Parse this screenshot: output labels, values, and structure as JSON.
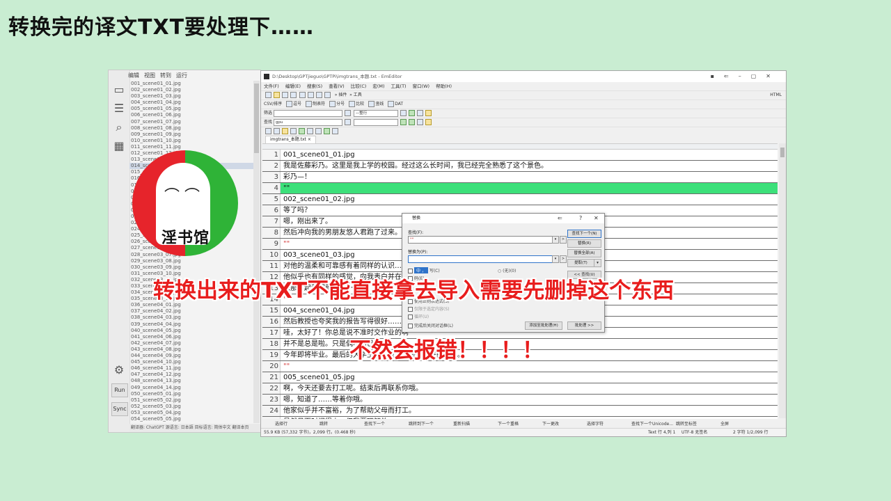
{
  "page_heading": "转换完的译文TXT要处理下……",
  "left_app": {
    "menu": [
      "编辑",
      "视图",
      "转到",
      "运行"
    ],
    "files": [
      "001_scene01_01.jpg",
      "002_scene01_02.jpg",
      "003_scene01_03.jpg",
      "004_scene01_04.jpg",
      "005_scene01_05.jpg",
      "006_scene01_06.jpg",
      "007_scene01_07.jpg",
      "008_scene01_08.jpg",
      "009_scene01_09.jpg",
      "010_scene01_10.jpg",
      "011_scene01_11.jpg",
      "012_scene01_12.jpg",
      "013_scene02_01.jpg",
      "014_scene02_02.jpg",
      "015_scene02_03.jpg",
      "016_scene02_04.jpg",
      "017_scene02_05.jpg",
      "018_scene02_06.jpg",
      "019_scene02_07.jpg",
      "020_scene02_08.jpg",
      "021_scene02_09.jpg",
      "022_scene02_10.jpg",
      "023_scene02_11.jpg",
      "024_scene02_12.jpg",
      "025_scene02_13.jpg",
      "026_scene03_01.jpg",
      "027_scene03_02.jpg",
      "028_scene03_07.jpg",
      "029_scene03_08.jpg",
      "030_scene03_09.jpg",
      "031_scene03_10.jpg",
      "032_scene03_11.jpg",
      "033_scene03_12.jpg",
      "034_scene03_13.jpg",
      "035_scene03_14.jpg",
      "036_scene04_01.jpg",
      "037_scene04_02.jpg",
      "038_scene04_03.jpg",
      "039_scene04_04.jpg",
      "040_scene04_05.jpg",
      "041_scene04_06.jpg",
      "042_scene04_07.jpg",
      "043_scene04_08.jpg",
      "044_scene04_09.jpg",
      "045_scene04_10.jpg",
      "046_scene04_11.jpg",
      "047_scene04_12.jpg",
      "048_scene04_13.jpg",
      "049_scene04_14.jpg",
      "050_scene05_01.jpg",
      "051_scene05_02.jpg",
      "052_scene05_03.jpg",
      "053_scene05_04.jpg",
      "054_scene05_05.jpg"
    ],
    "run_label": "Run",
    "sync_label": "Sync",
    "status": "翻译器:  ChatGPT   源语言: 日本語   目标语言: 简体中文   翻译本页"
  },
  "logo": {
    "text": "淫书馆",
    "face": "⌒ ⌒"
  },
  "editor": {
    "title": "D:\\Desktop\\GPTjieguo\\GPTPi\\imgtrans_本题.txt - EmEditor",
    "menu": [
      "文件(F)",
      "编辑(E)",
      "搜索(S)",
      "查看(V)",
      "比较(C)",
      "宏(M)",
      "工具(T)",
      "窗口(W)",
      "帮助(H)"
    ],
    "toolbar1_labels": [
      "插件",
      "工具"
    ],
    "html_label": "HTML",
    "toolbar2_labels": [
      "CSV/排序",
      "逗号",
      "制表符",
      "分号",
      "比较",
      "竖线",
      "DAT"
    ],
    "filter_label": "筛选",
    "find_label": "查找",
    "find_value": "gpu",
    "whole_line": "—整行",
    "tab_name": "imgtrans_本题.txt",
    "lines": [
      {
        "n": "1",
        "t": "001_scene01_01.jpg"
      },
      {
        "n": "2",
        "t": "我是佐藤彩乃。这里是我上学的校园。经过这么长时间，我已经完全熟悉了这个景色。"
      },
      {
        "n": "3",
        "t": "彩乃—！"
      },
      {
        "n": "4",
        "t": "\"\"",
        "hl": true
      },
      {
        "n": "5",
        "t": "002_scene01_02.jpg"
      },
      {
        "n": "6",
        "t": "等了吗？"
      },
      {
        "n": "7",
        "t": "嗯，刚出来了。"
      },
      {
        "n": "8",
        "t": "然后冲向我的男朋友悠人君跑了过来。"
      },
      {
        "n": "9",
        "t": "\"\"",
        "q": true
      },
      {
        "n": "10",
        "t": "003_scene01_03.jpg"
      },
      {
        "n": "11",
        "t": "对他的温柔和可靠感有着同样的认识……"
      },
      {
        "n": "12",
        "t": "他似乎也有同样的感觉，向我表白并在一"
      },
      {
        "n": "13",
        "t": "从那时起我们就是在一起"
      },
      {
        "n": "14",
        "t": "\"\"",
        "q": true
      },
      {
        "n": "15",
        "t": "004_scene01_04.jpg"
      },
      {
        "n": "16",
        "t": "然后教授也夸奖我的报告写得很好……"
      },
      {
        "n": "17",
        "t": "哇，太好了！你总是说不准时交作业的啊"
      },
      {
        "n": "18",
        "t": "并不是总是啦。只是偶尔而已。"
      },
      {
        "n": "19",
        "t": "今年即将毕业。最后的大学生活，也许会是最美好的一年。"
      },
      {
        "n": "20",
        "t": "\"\"",
        "q": true
      },
      {
        "n": "21",
        "t": "005_scene01_05.jpg"
      },
      {
        "n": "22",
        "t": "啊，今天还要去打工呢。结束后再联系你哦。"
      },
      {
        "n": "23",
        "t": "嗯，知道了……等着你哦。"
      },
      {
        "n": "24",
        "t": "他家似乎并不富裕，为了帮助父母而打工。"
      },
      {
        "n": "25",
        "t": "虽然见面时间很少，但我要理解他。"
      },
      {
        "n": "26",
        "t": "\"\"",
        "q": true
      }
    ],
    "funcbar": [
      "选择行",
      "跳转",
      "查找下一个",
      "跳转到下一个",
      "重新扫描",
      "下一个重格",
      "下一更改",
      "选择字符",
      "查找下一个Unicode...",
      "跳转至标签",
      "全屏"
    ],
    "status": {
      "left": "55.9 KB (57,332 字节)，2,099 行。(0.468 秒)",
      "pos": "Text  行 4,列 1",
      "enc": "UTF-8 无签名",
      "count": "2 字符  1/2,099 行"
    }
  },
  "dialog": {
    "title": "替换",
    "find_label": "查找(F):",
    "find_value": "\"\"",
    "replace_label": "替换为(P):",
    "replace_value": "",
    "ime": "中 ，",
    "opt_case": "写(C)",
    "opt_none": "(无)(0)",
    "opt_escape": "码(E)",
    "opt_regex": "使用正则表达式(S)",
    "opt_sel": "仅限于选定内容(S)",
    "opt_loop": "循环(U)",
    "opt_close": "完成后关闭对话框(L)",
    "btn_find_next": "查找下一个(N)",
    "btn_replace": "替换(R)",
    "btn_replace_all": "替换全部(A)",
    "btn_extract": "提取(T)",
    "btn_up": "<< 查找(U)",
    "btn_add_batch": "添加至批处理(H)",
    "btn_batch": "批处理 >>"
  },
  "overlay1": "转换出来的TXT不能直接拿去导入需要先删掉这个东西",
  "overlay2": "不然会报错！！！！"
}
